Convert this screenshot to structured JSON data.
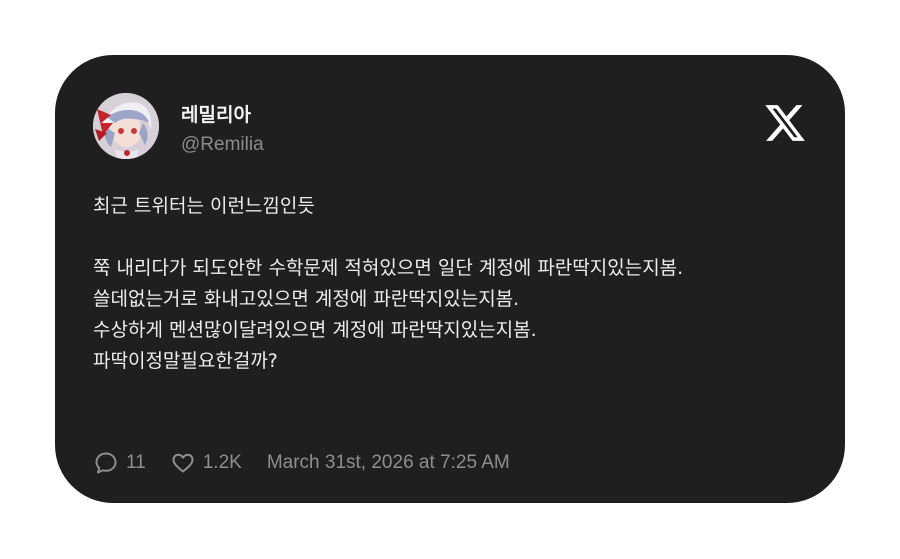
{
  "user": {
    "display_name": "레밀리아",
    "handle": "@Remilia",
    "avatar_icon": "anime-character-avatar"
  },
  "brand_icon": "x-logo-icon",
  "tweet": {
    "lines": {
      "l1": "최근 트위터는 이런느낌인듯",
      "l2": "쭉 내리다가 되도안한 수학문제 적혀있으면 일단 계정에 파란딱지있는지봄.",
      "l3": "쓸데없는거로 화내고있으면 계정에 파란딱지있는지봄.",
      "l4": "수상하게 멘션많이달려있으면 계정에 파란딱지있는지봄.",
      "l5": "파딱이정말필요한걸까?"
    }
  },
  "footer": {
    "replies": "11",
    "likes": "1.2K",
    "timestamp": "March 31st, 2026 at 7:25 AM",
    "reply_icon": "comment-icon",
    "like_icon": "heart-icon"
  },
  "colors": {
    "card_background": "#1f1f1f",
    "text_primary": "#ececec",
    "text_secondary": "#8b8b8b"
  }
}
